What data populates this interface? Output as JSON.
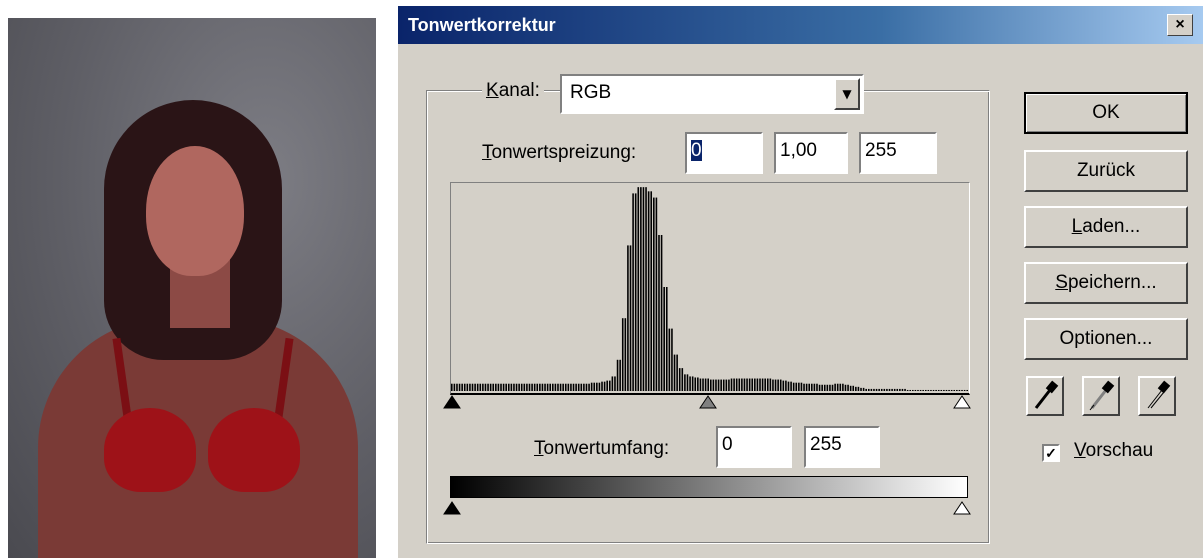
{
  "dialog": {
    "title": "Tonwertkorrektur",
    "close_glyph": "×"
  },
  "channel": {
    "label": "Kanal:",
    "label_accel": "K",
    "label_rest": "anal:",
    "value": "RGB"
  },
  "input_levels": {
    "label_accel": "T",
    "label_rest": "onwertspreizung:",
    "black": "0",
    "gamma": "1,00",
    "white": "255"
  },
  "output_levels": {
    "label_accel": "T",
    "label_rest": "onwertumfang:",
    "black": "0",
    "white": "255"
  },
  "buttons": {
    "ok": "OK",
    "reset": "Zurück",
    "load_accel": "L",
    "load_rest": "aden...",
    "save_accel": "S",
    "save_rest": "peichern...",
    "options": "Optionen..."
  },
  "eyedroppers": [
    "black-point-eyedropper-icon",
    "gray-point-eyedropper-icon",
    "white-point-eyedropper-icon"
  ],
  "preview": {
    "checked": true,
    "check_glyph": "✓",
    "label_accel": "V",
    "label_rest": "orschau"
  },
  "histogram": {
    "bins": [
      7,
      7,
      7,
      7,
      7,
      7,
      7,
      7,
      7,
      7,
      7,
      7,
      7,
      7,
      7,
      7,
      7,
      7,
      7,
      7,
      7,
      7,
      7,
      7,
      7,
      7,
      7,
      8,
      8,
      9,
      10,
      14,
      30,
      70,
      140,
      190,
      196,
      196,
      192,
      186,
      150,
      100,
      60,
      35,
      22,
      16,
      14,
      13,
      12,
      12,
      11,
      11,
      11,
      11,
      12,
      12,
      12,
      12,
      12,
      12,
      12,
      12,
      11,
      11,
      10,
      9,
      8,
      8,
      7,
      7,
      7,
      6,
      6,
      6,
      7,
      7,
      6,
      5,
      4,
      3,
      2,
      2,
      2,
      2,
      2,
      2,
      2,
      2,
      1,
      1,
      1,
      1,
      1,
      1,
      1,
      1,
      1,
      1,
      1,
      1
    ]
  }
}
